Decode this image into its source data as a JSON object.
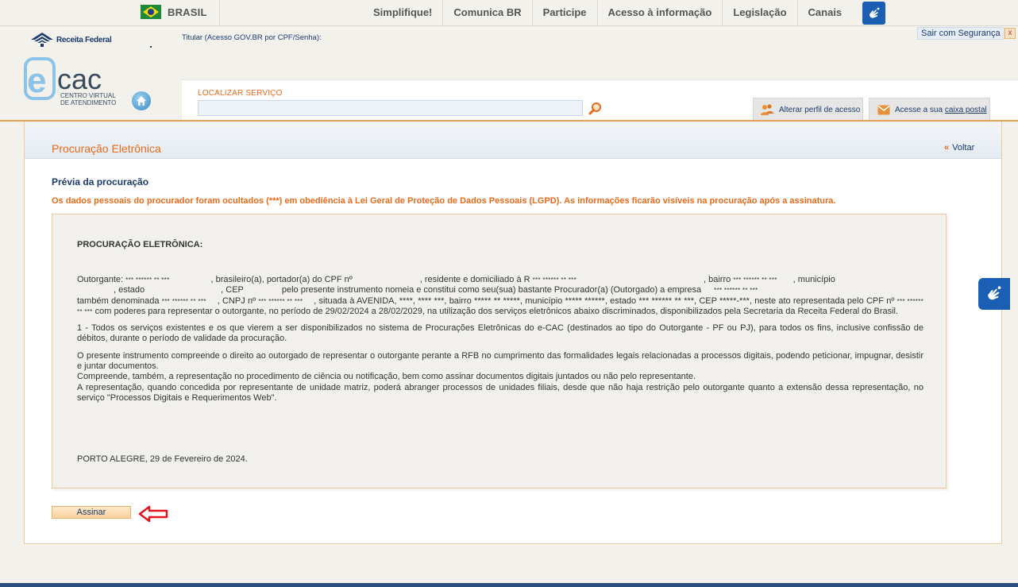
{
  "govbar": {
    "country": "BRASIL",
    "nav": [
      "Simplifique!",
      "Comunica BR",
      "Participe",
      "Acesso à informação",
      "Legislação",
      "Canais"
    ],
    "vlibras_icon": "hand-sign-icon"
  },
  "header": {
    "rfb_logo_text": "Receita Federal",
    "titular": "Titular (Acesso GOV.BR por CPF/Senha):",
    "sair_label": "Sair com Segurança",
    "close_glyph": "x",
    "ecac_sub_line1": "Centro Virtual",
    "ecac_sub_line2": "de Atendimento"
  },
  "search": {
    "label": "LOCALIZAR SERVIÇO",
    "value": "",
    "placeholder": ""
  },
  "actions": {
    "perfil_label": "Alterar perfil de acesso",
    "caixa_prefix": "Acesse a sua ",
    "caixa_link": "caixa postal"
  },
  "panel": {
    "title": "Procuração Eletrônica",
    "voltar_glyph": "«",
    "voltar_label": "Voltar",
    "previa_title": "Prévia da procuração",
    "lgpd_notice": "Os dados pessoais do procurador foram ocultados (***) em obediência à Lei Geral de Proteção de Dados Pessoais (LGPD). As informações ficarão visíveis na procuração após a assinatura."
  },
  "document": {
    "title": "PROCURAÇÃO ELETRÔNICA:",
    "p1_a": "Outorgante: ",
    "mask_name": "*** ****** ** ***",
    "p1_b": ", brasileiro(a), portador(a) do CPF nº",
    "p1_c": ", residente e domiciliado à R",
    "mask_addr": "*** ****** ** ***",
    "p1_d": ", bairro",
    "mask_bairro": "*** ****** ** ***",
    "p1_e": ", município",
    "p1_f": ", estado",
    "p1_g": ", CEP",
    "p1_h": "pelo presente instrumento nomeia e constitui como seu(sua) bastante Procurador(a) (Outorgado) a empresa",
    "mask_empresa": "*** ****** ** ***",
    "p1_i": "também denominada",
    "mask_denom": "*** ****** ** ***",
    "p1_j": ", CNPJ nº",
    "mask_cnpj": "*** ****** ** ***",
    "p1_k": ", situada à AVENIDA, ****, **** ***, bairro ***** ** *****, município ***** ******, estado *** ****** ** ***, CEP *****-***, neste ato representada pelo CPF nº",
    "mask_cpf": "*** ****** ** ***",
    "p1_l": "com poderes para representar o outorgante, no período de 29/02/2024 a 28/02/2029, na utilização dos serviços eletrônicos abaixo discriminados, disponibilizados pela Secretaria da Receita Federal do Brasil.",
    "p2": "1 - Todos os serviços existentes e os que vierem a ser disponibilizados no sistema de Procurações Eletrônicas do e-CAC (destinados ao tipo do Outorgante - PF ou PJ), para todos os fins, inclusive confissão de débitos, durante o período de validade da procuração.",
    "p3_a": "O presente instrumento compreende o direito ao outorgado de representar o outorgante perante a RFB no cumprimento das formalidades legais relacionadas a processos digitais, podendo peticionar, impugnar, desistir e juntar documentos.",
    "p3_b": "Compreende, também, a representação no procedimento de ciência ou notificação, bem como assinar documentos digitais juntados ou não pelo representante.",
    "p3_c": "A representação, quando concedida por representante de unidade matriz, poderá abranger processos de unidades filiais, desde que não haja restrição pelo outorgante quanto a extensão dessa representação, no serviço \"Processos Digitais e Requerimentos Web\".",
    "date": "PORTO ALEGRE, 29 de Fevereiro de 2024."
  },
  "buttons": {
    "assinar": "Assinar"
  },
  "colors": {
    "accent_orange": "#e86a1a",
    "navy": "#1b3a6b",
    "vlibras_blue": "#1a5fb4",
    "arrow_red": "#e0141e"
  }
}
